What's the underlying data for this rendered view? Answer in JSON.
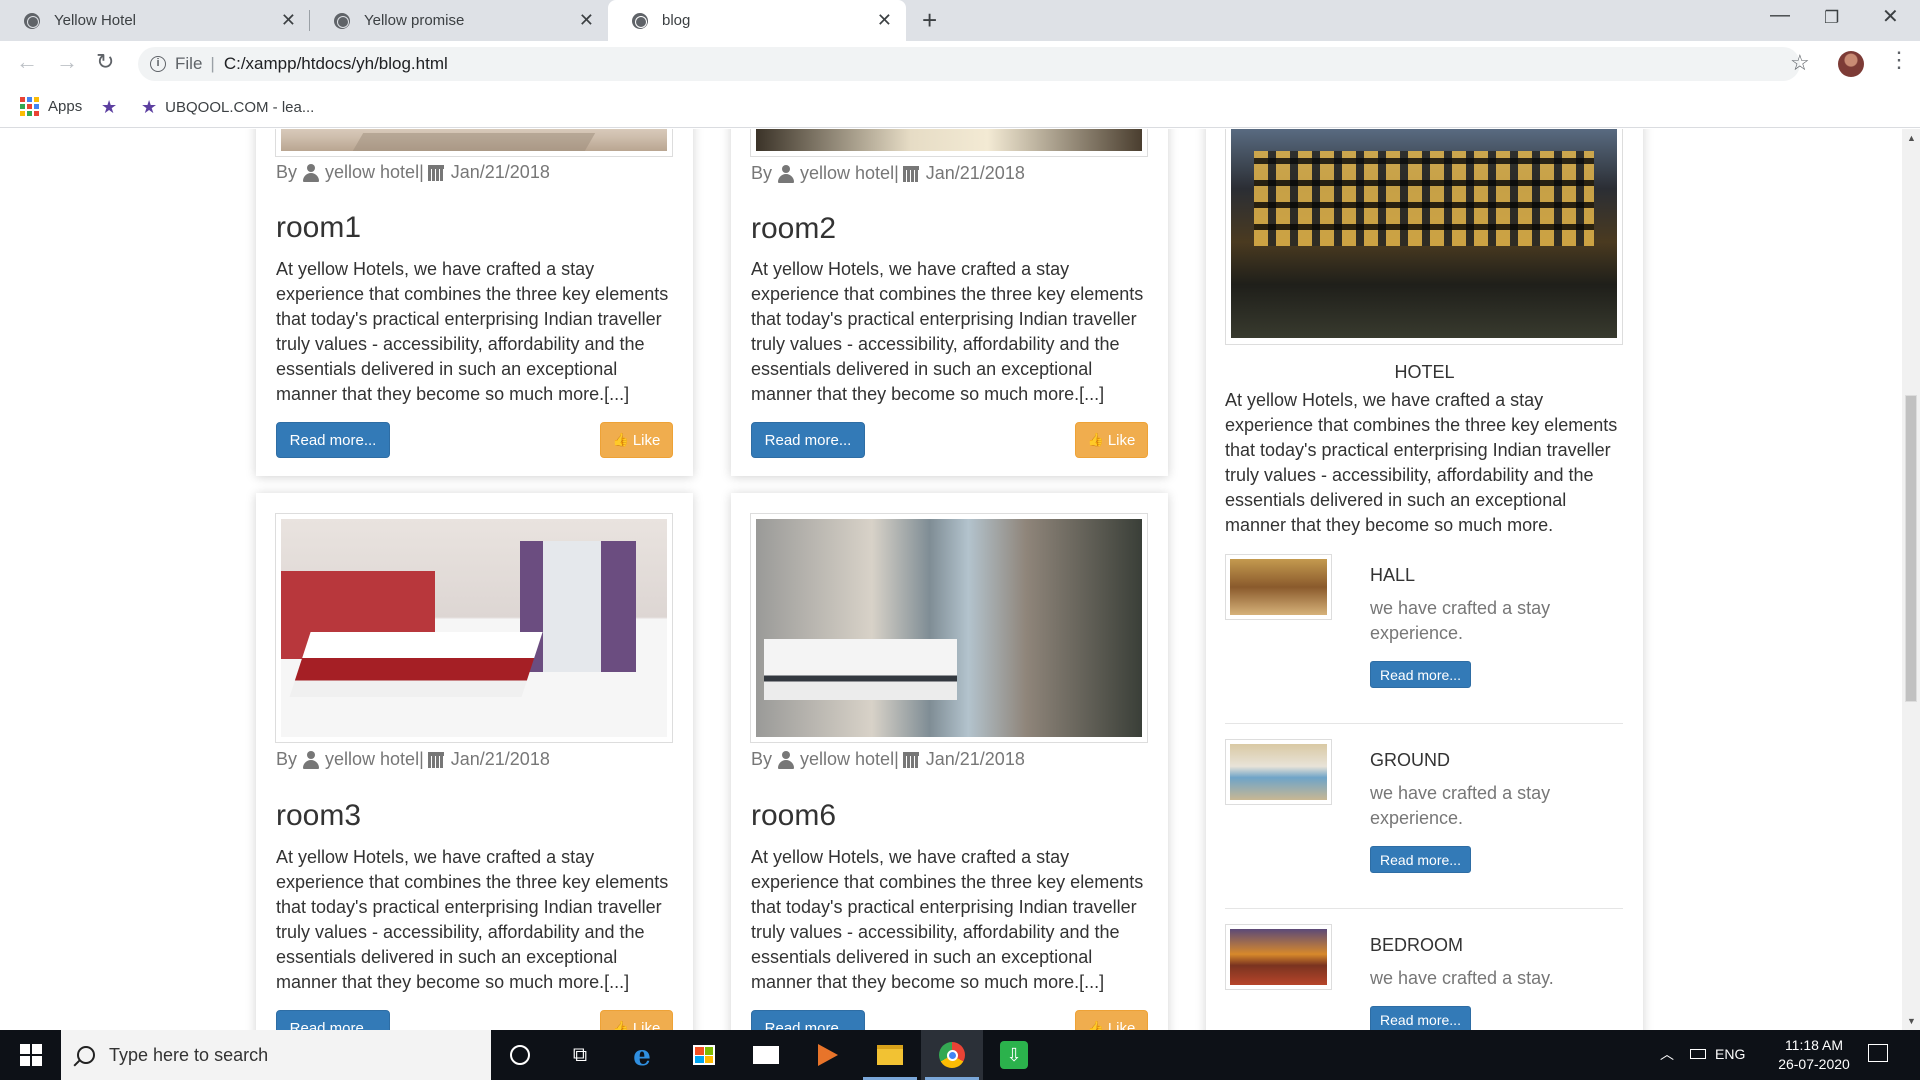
{
  "browser": {
    "tabs": [
      {
        "title": "Yellow Hotel"
      },
      {
        "title": "Yellow promise"
      },
      {
        "title": "blog"
      }
    ],
    "new_tab_label": "+",
    "address": {
      "scheme": "File",
      "url": "C:/xampp/htdocs/yh/blog.html"
    },
    "bookmarks": [
      {
        "label": "Apps"
      },
      {
        "label": ""
      },
      {
        "label": "UBQOOL.COM - lea..."
      }
    ]
  },
  "posts": [
    {
      "title": "room1",
      "author": "yellow hotel|",
      "date": "Jan/21/2018",
      "by": "By",
      "text": "At yellow Hotels, we have crafted a stay experience that combines the three key elements that today's practical enterprising Indian traveller truly values - accessibility, affordability and the essentials delivered in such an exceptional manner that they become so much more.[...]",
      "read_more": "Read more...",
      "like": "Like"
    },
    {
      "title": "room2",
      "author": "yellow hotel|",
      "date": "Jan/21/2018",
      "by": "By",
      "text": "At yellow Hotels, we have crafted a stay experience that combines the three key elements that today's practical enterprising Indian traveller truly values - accessibility, affordability and the essentials delivered in such an exceptional manner that they become so much more.[...]",
      "read_more": "Read more...",
      "like": "Like"
    },
    {
      "title": "room3",
      "author": "yellow hotel|",
      "date": "Jan/21/2018",
      "by": "By",
      "text": "At yellow Hotels, we have crafted a stay experience that combines the three key elements that today's practical enterprising Indian traveller truly values - accessibility, affordability and the essentials delivered in such an exceptional manner that they become so much more.[...]",
      "read_more": "Read more...",
      "like": "Like"
    },
    {
      "title": "room6",
      "author": "yellow hotel|",
      "date": "Jan/21/2018",
      "by": "By",
      "text": "At yellow Hotels, we have crafted a stay experience that combines the three key elements that today's practical enterprising Indian traveller truly values - accessibility, affordability and the essentials delivered in such an exceptional manner that they become so much more.[...]",
      "read_more": "Read more...",
      "like": "Like"
    }
  ],
  "sidebar": {
    "hotel_label": "HOTEL",
    "hotel_text": "At yellow Hotels, we have crafted a stay experience that combines the three key elements that today's practical enterprising Indian traveller truly values - accessibility, affordability and the essentials delivered in such an exceptional manner that they become so much more.",
    "items": [
      {
        "title": "HALL",
        "text": "we have crafted a stay experience.",
        "button": "Read more..."
      },
      {
        "title": "GROUND",
        "text": "we have crafted a stay experience.",
        "button": "Read more..."
      },
      {
        "title": "BEDROOM",
        "text": "we have crafted a stay.",
        "button": "Read more..."
      }
    ]
  },
  "taskbar": {
    "search_placeholder": "Type here to search",
    "language": "ENG",
    "time": "11:18 AM",
    "date": "26-07-2020"
  },
  "colors": {
    "primary": "#337ab7",
    "warning": "#f0ad4e",
    "taskbar": "#0d1117"
  }
}
